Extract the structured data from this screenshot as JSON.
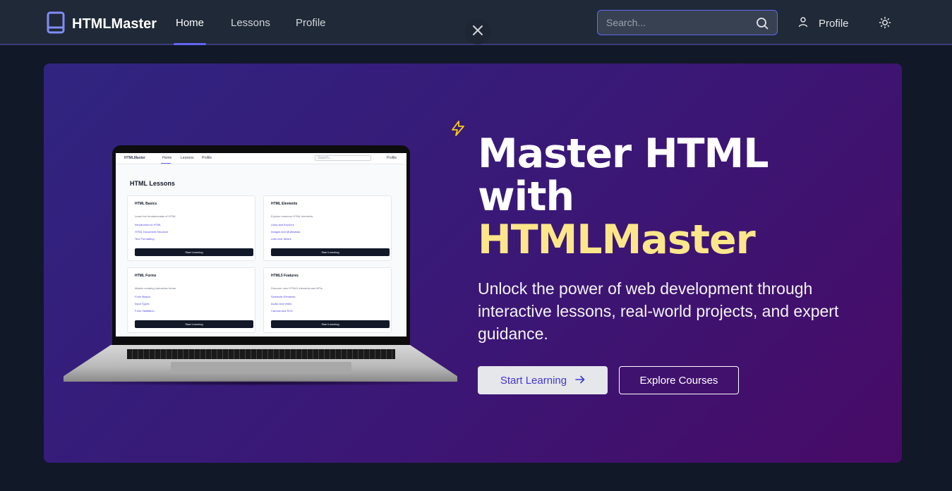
{
  "nav": {
    "brand": "HTMLMaster",
    "links": [
      {
        "label": "Home",
        "active": true
      },
      {
        "label": "Lessons",
        "active": false
      },
      {
        "label": "Profile",
        "active": false
      }
    ],
    "search_placeholder": "Search...",
    "profile_label": "Profile"
  },
  "hero": {
    "headline_line1": "Master HTML",
    "headline_line2": "with",
    "headline_accent": "HTMLMaster",
    "subtitle": "Unlock the power of web development through interactive lessons, real-world projects, and expert guidance.",
    "primary_button": "Start Learning",
    "secondary_button": "Explore Courses"
  },
  "laptop_screen": {
    "brand": "HTMLMaster",
    "links": [
      "Home",
      "Lessons",
      "Profile"
    ],
    "search_placeholder": "Search...",
    "profile_label": "Profile",
    "title": "HTML Lessons",
    "cards": [
      {
        "title": "HTML Basics",
        "desc": "Learn the fundamentals of HTML",
        "links": [
          "Introduction to HTML",
          "HTML Document Structure",
          "Text Formatting"
        ],
        "button": "Start Learning"
      },
      {
        "title": "HTML Elements",
        "desc": "Explore common HTML elements",
        "links": [
          "Links and Anchors",
          "Images and Multimedia",
          "Lists and Tables"
        ],
        "button": "Start Learning"
      },
      {
        "title": "HTML Forms",
        "desc": "Master creating interactive forms",
        "links": [
          "Form Basics",
          "Input Types",
          "Form Validation"
        ],
        "button": "Start Learning"
      },
      {
        "title": "HTML5 Features",
        "desc": "Discover new HTML5 elements and APIs",
        "links": [
          "Semantic Elements",
          "Audio and Video",
          "Canvas and SVG"
        ],
        "button": "Start Learning"
      }
    ]
  },
  "colors": {
    "nav_bg": "#1f2937",
    "page_bg": "#111827",
    "accent": "#6366f1",
    "headline_accent": "#fde68a"
  },
  "icons": [
    "book-icon",
    "close-icon",
    "search-icon",
    "user-icon",
    "sun-icon",
    "lightning-icon",
    "arrow-right-icon"
  ]
}
